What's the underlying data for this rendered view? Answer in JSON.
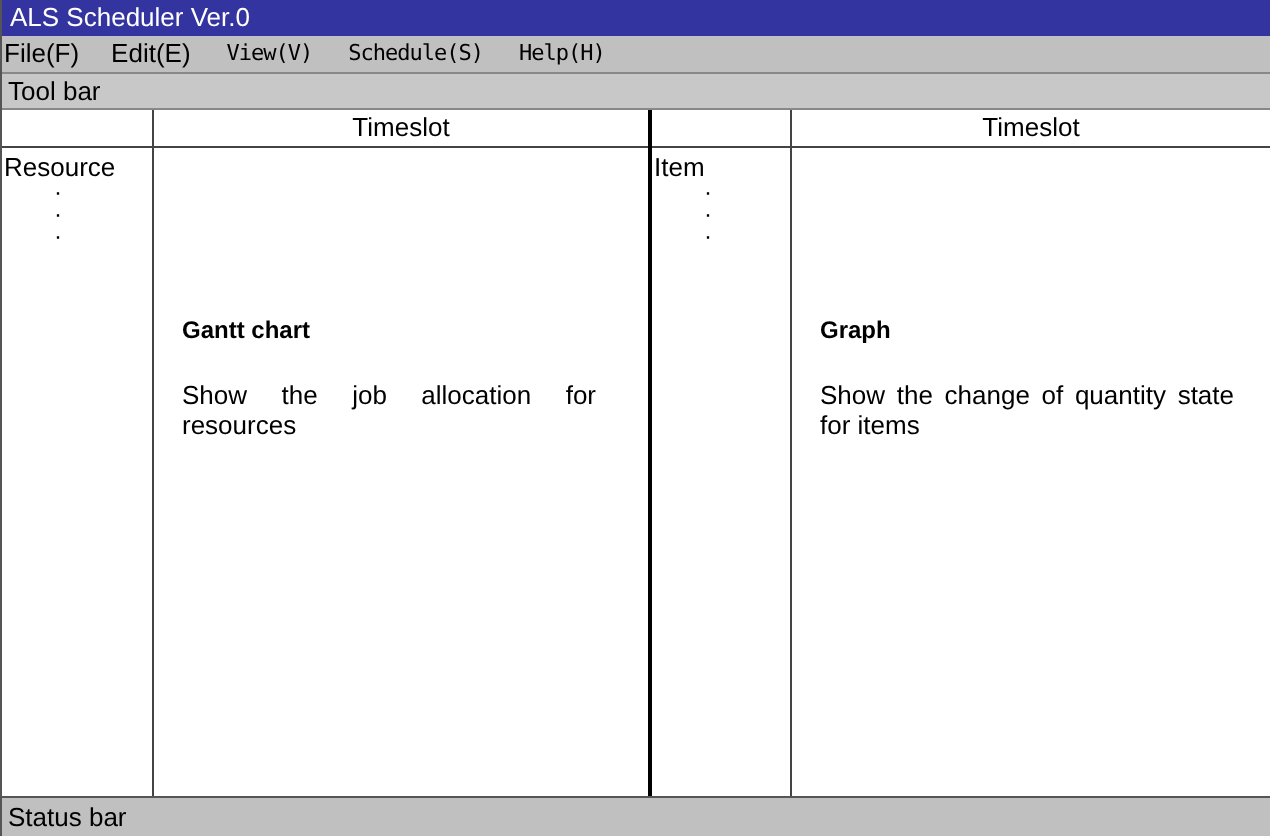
{
  "window": {
    "title": "ALS Scheduler Ver.0"
  },
  "menu": [
    {
      "label": "File(F)",
      "kind": "sans"
    },
    {
      "label": "Edit(E)",
      "kind": "sans"
    },
    {
      "label": "View(V)",
      "kind": "mono"
    },
    {
      "label": "Schedule(S)",
      "kind": "mono"
    },
    {
      "label": "Help(H)",
      "kind": "mono"
    }
  ],
  "toolbar": {
    "label": "Tool bar"
  },
  "panes": [
    {
      "header": "Timeslot",
      "row_label": "Resource",
      "dots": [
        "·",
        "·",
        "·"
      ],
      "title": "Gantt chart",
      "description": "Show the job allocation for resources"
    },
    {
      "header": "Timeslot",
      "row_label": "Item",
      "dots": [
        "·",
        "·",
        "·"
      ],
      "title": "Graph",
      "description": "Show the change of quantity state for items"
    }
  ],
  "status_bar": {
    "label": "Status bar"
  }
}
